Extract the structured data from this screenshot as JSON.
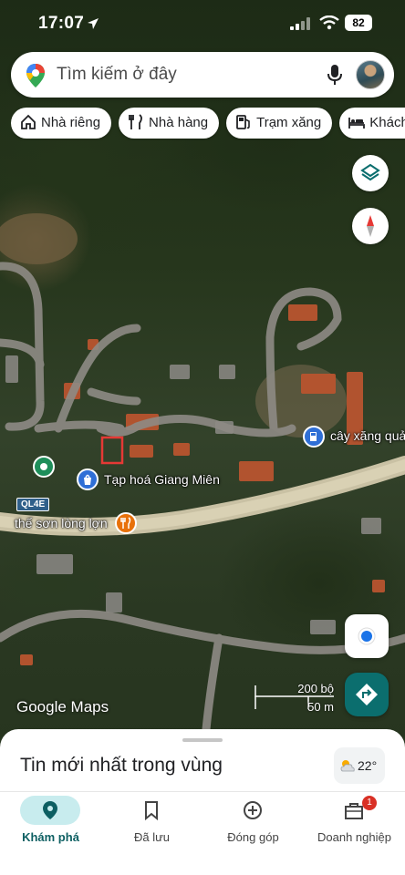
{
  "status_bar": {
    "time": "17:07",
    "battery": "82"
  },
  "search": {
    "placeholder": "Tìm kiếm ở đây"
  },
  "chips": [
    {
      "label": "Nhà riêng",
      "icon": "home-icon"
    },
    {
      "label": "Nhà hàng",
      "icon": "restaurant-icon"
    },
    {
      "label": "Trạm xăng",
      "icon": "gas-station-icon"
    },
    {
      "label": "Khách",
      "icon": "hotel-icon"
    }
  ],
  "map": {
    "labels": {
      "gas_station": "cây xăng quả",
      "grocery": "Tạp hoá Giang Miên",
      "restaurant": "thế sơn lòng lợn",
      "road_shield": "QL4E"
    },
    "attribution": "Google Maps",
    "scale": {
      "imperial": "200 bộ",
      "metric": "50 m"
    },
    "colors": {
      "poi_blue": "#2f6fd6",
      "poi_green": "#1e8e5a",
      "poi_orange": "#e8710a",
      "marker_red": "#e53935"
    }
  },
  "sheet": {
    "title": "Tin mới nhất trong vùng",
    "temperature": "22°"
  },
  "nav": {
    "items": [
      {
        "label": "Khám phá",
        "icon": "explore-pin-icon",
        "active": true
      },
      {
        "label": "Đã lưu",
        "icon": "bookmark-icon"
      },
      {
        "label": "Đóng góp",
        "icon": "add-circle-icon"
      },
      {
        "label": "Doanh nghiệp",
        "icon": "business-icon",
        "badge": "1"
      }
    ]
  }
}
